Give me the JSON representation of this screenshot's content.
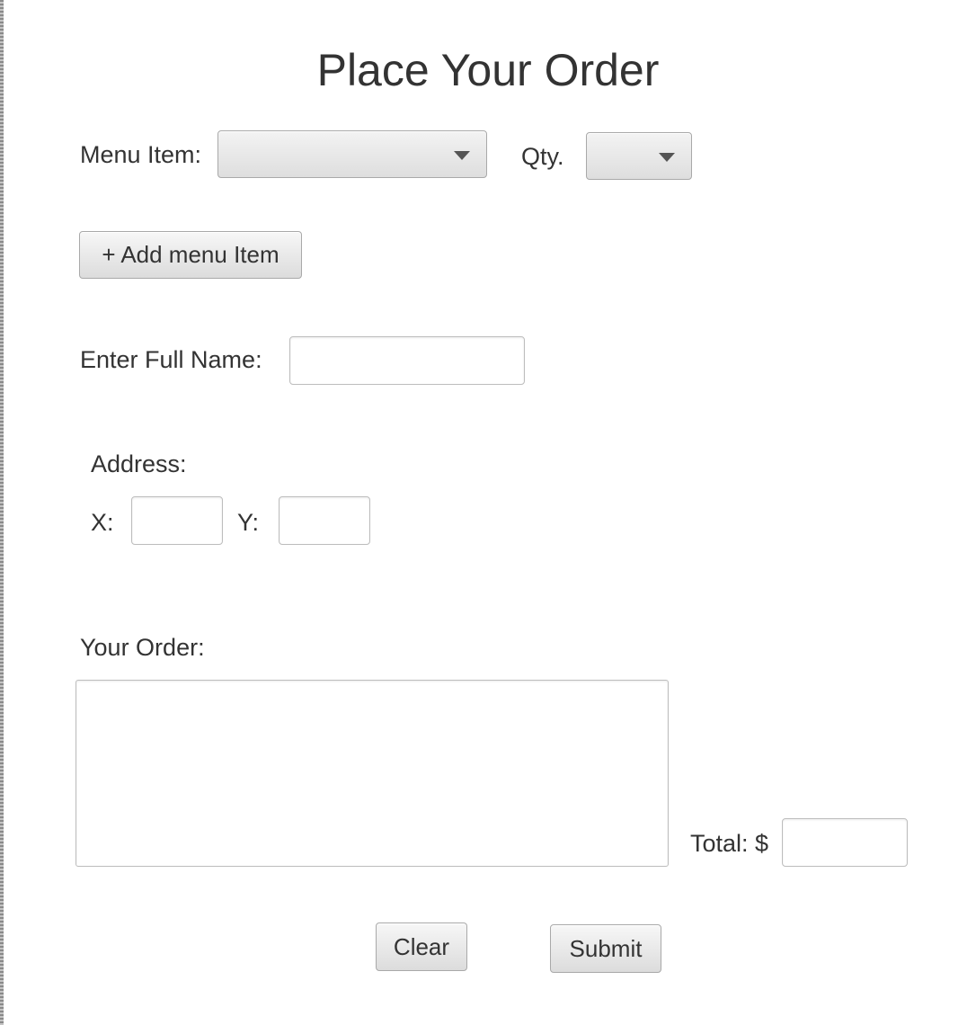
{
  "form": {
    "title": "Place Your Order",
    "menu_item_label": "Menu Item:",
    "menu_item_value": "",
    "qty_label": "Qty.",
    "qty_value": "",
    "add_button_label": "+ Add menu Item",
    "full_name_label": "Enter Full Name:",
    "full_name_value": "",
    "address_label": "Address:",
    "x_label": "X:",
    "x_value": "",
    "y_label": "Y:",
    "y_value": "",
    "your_order_label": "Your Order:",
    "your_order_value": "",
    "total_label": "Total: $",
    "total_value": "",
    "clear_button_label": "Clear",
    "submit_button_label": "Submit"
  },
  "icons": {
    "menu_item_dropdown": "chevron-down-icon",
    "qty_dropdown": "chevron-down-icon"
  },
  "colors": {
    "text": "#333333",
    "control_border": "#a9a9a9",
    "field_border": "#bdbdbd",
    "background": "#ffffff"
  }
}
